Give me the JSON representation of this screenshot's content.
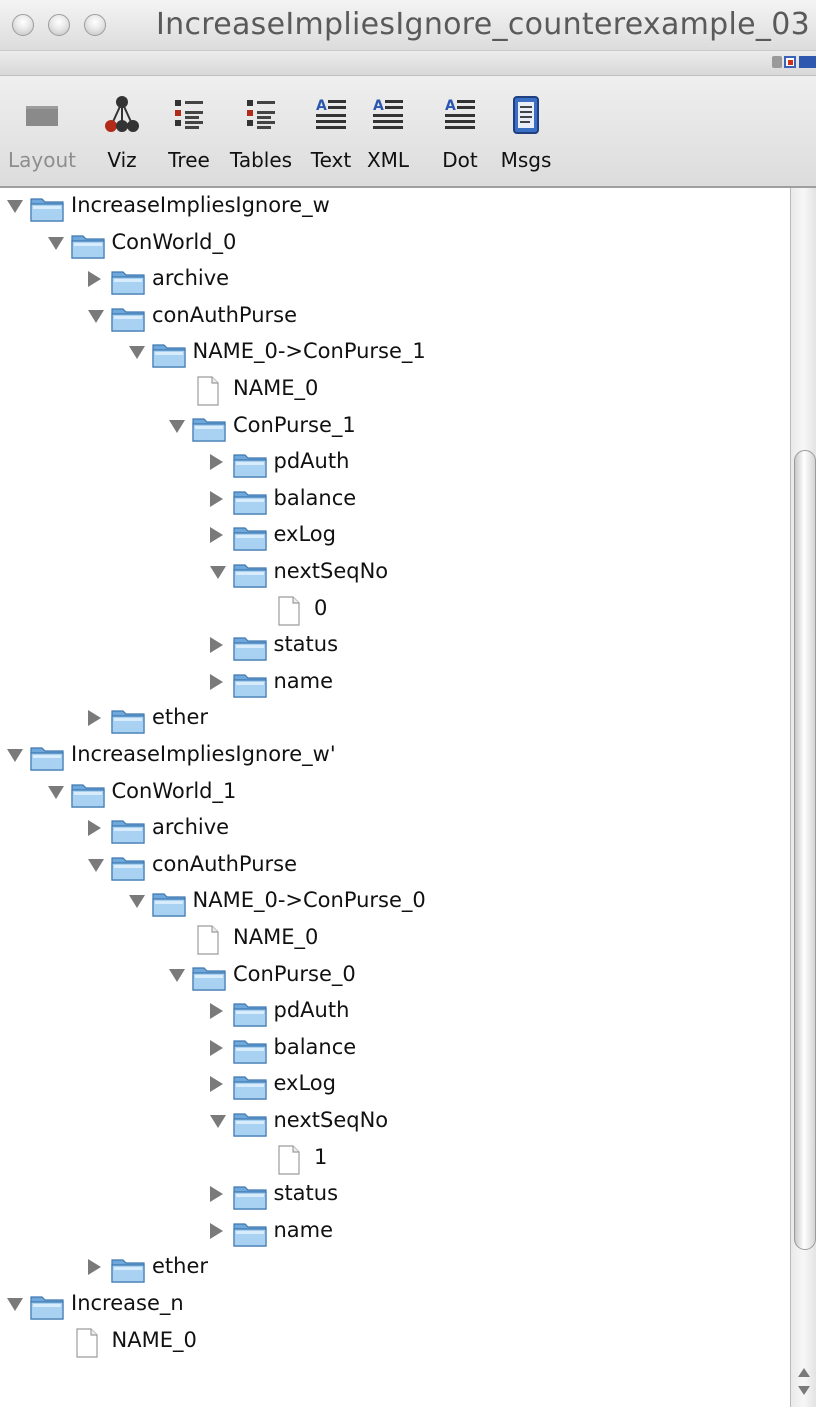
{
  "window": {
    "title": "IncreaseImpliesIgnore_counterexample_03"
  },
  "toolbar": {
    "items": [
      {
        "label": "Layout",
        "icon": "layout-icon"
      },
      {
        "label": "Viz",
        "icon": "graph-icon"
      },
      {
        "label": "Tree",
        "icon": "tree-icon"
      },
      {
        "label": "Tables",
        "icon": "tables-icon"
      },
      {
        "label": "Text",
        "icon": "text-icon"
      },
      {
        "label": "XML",
        "icon": "xml-icon"
      },
      {
        "label": "Dot",
        "icon": "dot-icon"
      },
      {
        "label": "Msgs",
        "icon": "scroll-icon"
      }
    ]
  },
  "tree": {
    "rows": [
      {
        "label": "IncreaseImpliesIgnore_w",
        "depth": 0,
        "type": "folder",
        "state": "expanded"
      },
      {
        "label": "ConWorld_0",
        "depth": 1,
        "type": "folder",
        "state": "expanded"
      },
      {
        "label": "archive",
        "depth": 2,
        "type": "folder",
        "state": "collapsed"
      },
      {
        "label": "conAuthPurse",
        "depth": 2,
        "type": "folder",
        "state": "expanded"
      },
      {
        "label": "NAME_0->ConPurse_1",
        "depth": 3,
        "type": "folder",
        "state": "expanded"
      },
      {
        "label": "NAME_0",
        "depth": 4,
        "type": "leaf",
        "state": "none"
      },
      {
        "label": "ConPurse_1",
        "depth": 4,
        "type": "folder",
        "state": "expanded"
      },
      {
        "label": "pdAuth",
        "depth": 5,
        "type": "folder",
        "state": "collapsed"
      },
      {
        "label": "balance",
        "depth": 5,
        "type": "folder",
        "state": "collapsed"
      },
      {
        "label": "exLog",
        "depth": 5,
        "type": "folder",
        "state": "collapsed"
      },
      {
        "label": "nextSeqNo",
        "depth": 5,
        "type": "folder",
        "state": "expanded"
      },
      {
        "label": "0",
        "depth": 6,
        "type": "leaf",
        "state": "none"
      },
      {
        "label": "status",
        "depth": 5,
        "type": "folder",
        "state": "collapsed"
      },
      {
        "label": "name",
        "depth": 5,
        "type": "folder",
        "state": "collapsed"
      },
      {
        "label": "ether",
        "depth": 2,
        "type": "folder",
        "state": "collapsed"
      },
      {
        "label": "IncreaseImpliesIgnore_w'",
        "depth": 0,
        "type": "folder",
        "state": "expanded"
      },
      {
        "label": "ConWorld_1",
        "depth": 1,
        "type": "folder",
        "state": "expanded"
      },
      {
        "label": "archive",
        "depth": 2,
        "type": "folder",
        "state": "collapsed"
      },
      {
        "label": "conAuthPurse",
        "depth": 2,
        "type": "folder",
        "state": "expanded"
      },
      {
        "label": "NAME_0->ConPurse_0",
        "depth": 3,
        "type": "folder",
        "state": "expanded"
      },
      {
        "label": "NAME_0",
        "depth": 4,
        "type": "leaf",
        "state": "none"
      },
      {
        "label": "ConPurse_0",
        "depth": 4,
        "type": "folder",
        "state": "expanded"
      },
      {
        "label": "pdAuth",
        "depth": 5,
        "type": "folder",
        "state": "collapsed"
      },
      {
        "label": "balance",
        "depth": 5,
        "type": "folder",
        "state": "collapsed"
      },
      {
        "label": "exLog",
        "depth": 5,
        "type": "folder",
        "state": "collapsed"
      },
      {
        "label": "nextSeqNo",
        "depth": 5,
        "type": "folder",
        "state": "expanded"
      },
      {
        "label": "1",
        "depth": 6,
        "type": "leaf",
        "state": "none"
      },
      {
        "label": "status",
        "depth": 5,
        "type": "folder",
        "state": "collapsed"
      },
      {
        "label": "name",
        "depth": 5,
        "type": "folder",
        "state": "collapsed"
      },
      {
        "label": "ether",
        "depth": 2,
        "type": "folder",
        "state": "collapsed"
      },
      {
        "label": "Increase_n",
        "depth": 0,
        "type": "folder",
        "state": "expanded"
      },
      {
        "label": "NAME_0",
        "depth": 1,
        "type": "leaf",
        "state": "none"
      }
    ]
  },
  "colors": {
    "folder": "#7fb6e4",
    "arrow": "#7a7a7a",
    "scrollbar_thumb": "#ffffff"
  }
}
